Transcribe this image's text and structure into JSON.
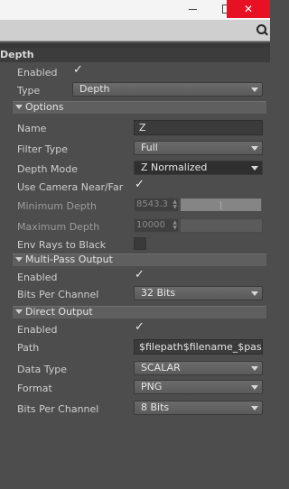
{
  "panel_title": "Depth",
  "fields": {
    "enabled_label": "Enabled",
    "type_label": "Type",
    "type_value": "Depth"
  },
  "options": {
    "title": "Options",
    "name_label": "Name",
    "name_value": "Z",
    "filter_type_label": "Filter Type",
    "filter_type_value": "Full",
    "depth_mode_label": "Depth Mode",
    "depth_mode_value": "Z Normalized",
    "use_camera_label": "Use Camera Near/Far",
    "min_depth_label": "Minimum Depth",
    "min_depth_value": "8543.3",
    "min_depth_fill": 0.99,
    "max_depth_label": "Maximum Depth",
    "max_depth_value": "10000",
    "max_depth_fill": 0.0,
    "env_rays_label": "Env Rays to Black"
  },
  "multipass": {
    "title": "Multi-Pass Output",
    "enabled_label": "Enabled",
    "bits_label": "Bits Per Channel",
    "bits_value": "32 Bits"
  },
  "direct": {
    "title": "Direct Output",
    "enabled_label": "Enabled",
    "path_label": "Path",
    "path_value": "$filepath$filename_$pass",
    "data_type_label": "Data Type",
    "data_type_value": "SCALAR",
    "format_label": "Format",
    "format_value": "PNG",
    "bits_label": "Bits Per Channel",
    "bits_value": "8 Bits"
  },
  "icons": {
    "search": "search-icon",
    "minimize": "minimize-icon",
    "maximize": "maximize-icon",
    "close": "close-icon",
    "checkmark": "checkmark-icon",
    "collapse": "triangle-down-icon",
    "dropdown": "chevron-down-icon"
  },
  "colors": {
    "panel_bg": "#4d4d4d",
    "section_bg": "#5f5f5f",
    "close_button": "#e81123"
  }
}
